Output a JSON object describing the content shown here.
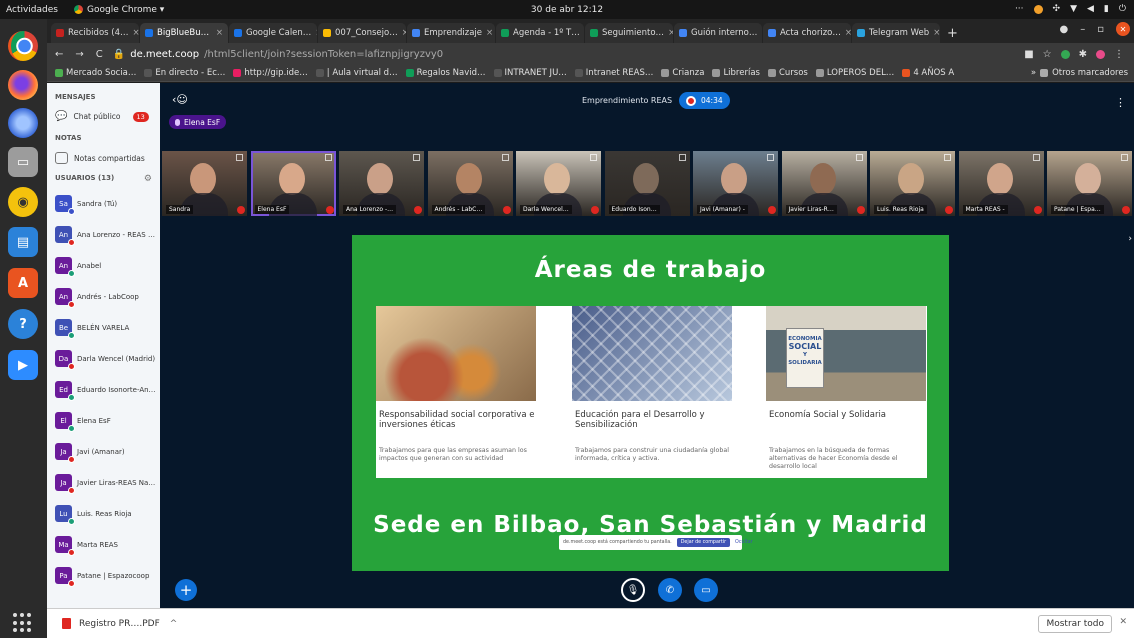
{
  "os": {
    "activities": "Actividades",
    "app_name": "Google Chrome ▾",
    "clock": "30 de abr 12:12"
  },
  "tabs": [
    {
      "label": "Recibidos (4…",
      "color": "#c5221f"
    },
    {
      "label": "BigBlueBu…",
      "color": "#1a73e8"
    },
    {
      "label": "Google Calen…",
      "color": "#1a73e8"
    },
    {
      "label": "007_Consejo…",
      "color": "#fbbc04"
    },
    {
      "label": "Emprendizaje",
      "color": "#4285f4"
    },
    {
      "label": "Agenda - 1º T…",
      "color": "#0f9d58"
    },
    {
      "label": "Seguimiento…",
      "color": "#0f9d58"
    },
    {
      "label": "Guión interno…",
      "color": "#4285f4"
    },
    {
      "label": "Acta chorizo…",
      "color": "#4285f4"
    },
    {
      "label": "Telegram Web",
      "color": "#2aa3df"
    }
  ],
  "address": {
    "host": "de.meet.coop",
    "path": "/html5client/join?sessionToken=lafiznpjigryzvy0"
  },
  "bookmarks": [
    "Mercado Socia…",
    "En directo - Ec…",
    "http://gip.ide…",
    "| Aula virtual d…",
    "Regalos Navid…",
    "INTRANET JU…",
    "Intranet REAS…",
    "Crianza",
    "Librerías",
    "Cursos",
    "LOPEROS DEL…",
    "4 AÑOS A"
  ],
  "bookmarks_other": "Otros marcadores",
  "sidebar": {
    "messages_header": "MENSAJES",
    "public_chat": "Chat público",
    "chat_count": "13",
    "notes_header": "NOTAS",
    "shared_notes": "Notas compartidas",
    "users_header": "USUARIOS (13)",
    "users": [
      {
        "initials": "Sa",
        "name": "Sandra (Tú)",
        "color": "#3b50c8",
        "status": "#3b50c8"
      },
      {
        "initials": "An",
        "name": "Ana Lorenzo - REAS …",
        "color": "#3f51b5",
        "status": "#df2721"
      },
      {
        "initials": "An",
        "name": "Anabel",
        "color": "#6a1b9a",
        "status": "#1b9e77"
      },
      {
        "initials": "An",
        "name": "Andrés - LabCoop",
        "color": "#6a1b9a",
        "status": "#df2721"
      },
      {
        "initials": "Be",
        "name": "BELÉN VARELA",
        "color": "#3f51b5",
        "status": "#1b9e77"
      },
      {
        "initials": "Da",
        "name": "Darla Wencel (Madrid)",
        "color": "#6a1b9a",
        "status": "#df2721"
      },
      {
        "initials": "Ed",
        "name": "Eduardo Isonorte-An…",
        "color": "#6a1b9a",
        "status": "#1b9e77"
      },
      {
        "initials": "El",
        "name": "Elena EsF",
        "color": "#6a1b9a",
        "status": "#1b9e77"
      },
      {
        "initials": "Ja",
        "name": "Javi (Amanar)",
        "color": "#6a1b9a",
        "status": "#df2721"
      },
      {
        "initials": "Ja",
        "name": "Javier Liras-REAS Na…",
        "color": "#6a1b9a",
        "status": "#df2721"
      },
      {
        "initials": "Lu",
        "name": "Luis. Reas Rioja",
        "color": "#3f51b5",
        "status": "#1b9e77"
      },
      {
        "initials": "Ma",
        "name": "Marta REAS",
        "color": "#6a1b9a",
        "status": "#df2721"
      },
      {
        "initials": "Pa",
        "name": "Patane | Espazocoop",
        "color": "#6a1b9a",
        "status": "#df2721"
      }
    ]
  },
  "meeting": {
    "title": "Emprendimiento REAS",
    "timer": "04:34",
    "talker": "Elena EsF"
  },
  "videos": [
    {
      "name": "Sandra",
      "bg": "#6b5448",
      "face": "#c9977a",
      "muted": true
    },
    {
      "name": "Elena EsF",
      "bg": "#8a7a6a",
      "face": "#d8a88a",
      "muted": true
    },
    {
      "name": "Ana Lorenzo -…",
      "bg": "#5d574f",
      "face": "#caa088",
      "muted": true
    },
    {
      "name": "Andrés - LabC…",
      "bg": "#7c6f63",
      "face": "#b48464",
      "muted": true
    },
    {
      "name": "Darla Wencel…",
      "bg": "#c9c3b8",
      "face": "#d9b79a",
      "muted": true
    },
    {
      "name": "Eduardo Ison…",
      "bg": "#3a3734",
      "face": "#7e6a5a",
      "muted": false
    },
    {
      "name": "Javi (Amanar) -",
      "bg": "#6d7f8f",
      "face": "#c99f86",
      "muted": true
    },
    {
      "name": "Javier Liras-R…",
      "bg": "#b8b0a2",
      "face": "#8f6a52",
      "muted": true
    },
    {
      "name": "Luis. Reas Rioja",
      "bg": "#b9ab95",
      "face": "#c9a585",
      "muted": true
    },
    {
      "name": "Marta REAS -",
      "bg": "#7d7468",
      "face": "#d0a58b",
      "muted": true
    },
    {
      "name": "Patane | Espa…",
      "bg": "#b5a48e",
      "face": "#d4b09a",
      "muted": true
    }
  ],
  "slide": {
    "title": "Áreas de trabajo",
    "footer": "Sede en Bilbao, San Sebastián y Madrid",
    "cards": [
      {
        "title": "Responsabilidad social corporativa e inversiones éticas",
        "desc": "Trabajamos para que las empresas asuman los impactos que generan con su actividad",
        "img_a": "#b8553a",
        "img_b": "#e6c89a"
      },
      {
        "title": "Educación para el Desarrollo y Sensibilización",
        "desc": "Trabajamos para construir una ciudadanía global informada, crítica y activa.",
        "img_a": "#4a5d8a",
        "img_b": "#b8c8dd"
      },
      {
        "title": "Economía Social y Solidaria",
        "desc": "Trabajamos en la búsqueda de formas alternativas de hacer Economía desde el desarrollo local",
        "img_a": "#5b6b72",
        "img_b": "#d7d2c5"
      }
    ],
    "sign_lines": [
      "ECONOMIA",
      "SOCIAL",
      "Y",
      "SOLIDARIA"
    ]
  },
  "share_bar": {
    "message": "de.meet.coop está compartiendo tu pantalla.",
    "stop": "Dejar de compartir",
    "hide": "Ocultar"
  },
  "download": {
    "file": "Registro PR….PDF",
    "show_all": "Mostrar todo"
  }
}
